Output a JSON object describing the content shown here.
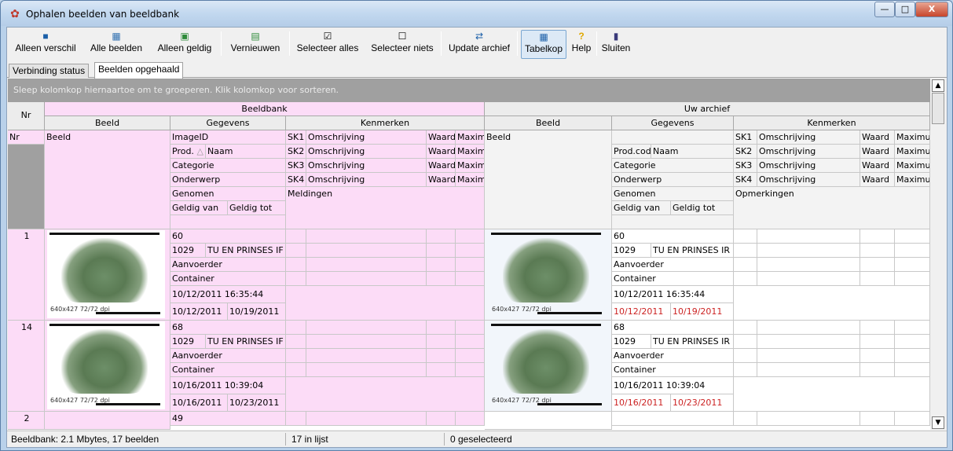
{
  "window": {
    "title": "Ophalen beelden van beeldbank",
    "minimize": "—",
    "maximize": "□",
    "close": "X"
  },
  "toolbar": {
    "items": [
      {
        "label": "Alleen verschil",
        "icon": "■"
      },
      {
        "label": "Alle beelden",
        "icon": "▦"
      },
      {
        "label": "Alleen geldig",
        "icon": "▣"
      },
      {
        "label": "Vernieuwen",
        "icon": "▤"
      },
      {
        "label": "Selecteer alles",
        "icon": "☑"
      },
      {
        "label": "Selecteer niets",
        "icon": "☐"
      },
      {
        "label": "Update archief",
        "icon": "⇄"
      },
      {
        "label": "Tabelkop",
        "icon": "▦"
      },
      {
        "label": "Help",
        "icon": "?"
      },
      {
        "label": "Sluiten",
        "icon": "▮"
      }
    ]
  },
  "tabs": [
    {
      "label": "Verbinding status"
    },
    {
      "label": "Beelden opgehaald"
    }
  ],
  "grid": {
    "group_hint": "Sleep kolomkop hiernaartoe om te groeperen. Klik kolomkop voor sorteren.",
    "band_nr": "Nr",
    "band_left": "Beeldbank",
    "band_right": "Uw archief",
    "sub_beeld": "Beeld",
    "sub_gegevens": "Gegevens",
    "sub_kenmerken": "Kenmerken",
    "left": {
      "nr": "Nr",
      "beeld": "Beeld",
      "imageid": "ImageID",
      "prod": "Prod.",
      "sort_icon": "△",
      "naam": "Naam",
      "categorie": "Categorie",
      "onderwerp": "Onderwerp",
      "genomen": "Genomen",
      "geldig_van": "Geldig van",
      "geldig_tot": "Geldig tot",
      "sk": [
        "SK1",
        "SK2",
        "SK3",
        "SK4"
      ],
      "omschrijving": "Omschrijving",
      "waard": "Waard",
      "maxim": "Maxim",
      "meldingen": "Meldingen"
    },
    "right": {
      "beeld": "Beeld",
      "prodcode": "Prod.cod",
      "naam": "Naam",
      "categorie": "Categorie",
      "onderwerp": "Onderwerp",
      "genomen": "Genomen",
      "geldig_van": "Geldig van",
      "geldig_tot": "Geldig tot",
      "sk": [
        "SK1",
        "SK2",
        "SK3",
        "SK4"
      ],
      "omschrijving": "Omschrijving",
      "waard": "Waard",
      "maxim": "Maximu",
      "opmerkingen": "Opmerkingen"
    },
    "rows": [
      {
        "nr": "1",
        "imageid": "60",
        "prod": "1029",
        "naam": "TU EN PRINSES IF",
        "naam_r": "TU EN PRINSES IR",
        "categorie": "Aanvoerder",
        "onderwerp": "Container",
        "genomen": "10/12/2011 16:35:44",
        "geldig_van": "10/12/2011",
        "geldig_tot": "10/19/2011",
        "img_label": "640x427 72/72 dpi"
      },
      {
        "nr": "14",
        "imageid": "68",
        "prod": "1029",
        "naam": "TU EN PRINSES IF",
        "naam_r": "TU EN PRINSES IR",
        "categorie": "Aanvoerder",
        "onderwerp": "Container",
        "genomen": "10/16/2011 10:39:04",
        "geldig_van": "10/16/2011",
        "geldig_tot": "10/23/2011",
        "img_label": "640x427 72/72 dpi"
      },
      {
        "nr": "2",
        "imageid": "49"
      }
    ]
  },
  "status": {
    "beeldbank": "Beeldbank:   2.1 Mbytes, 17 beelden",
    "in_lijst": "17 in lijst",
    "geselecteerd": "0 geselecteerd"
  },
  "scroll": {
    "up": "▲",
    "down": "▼"
  },
  "colors": {
    "pink": "#fcdcf7",
    "grey_header": "#a0a0a0",
    "red_date": "#cc2222"
  }
}
